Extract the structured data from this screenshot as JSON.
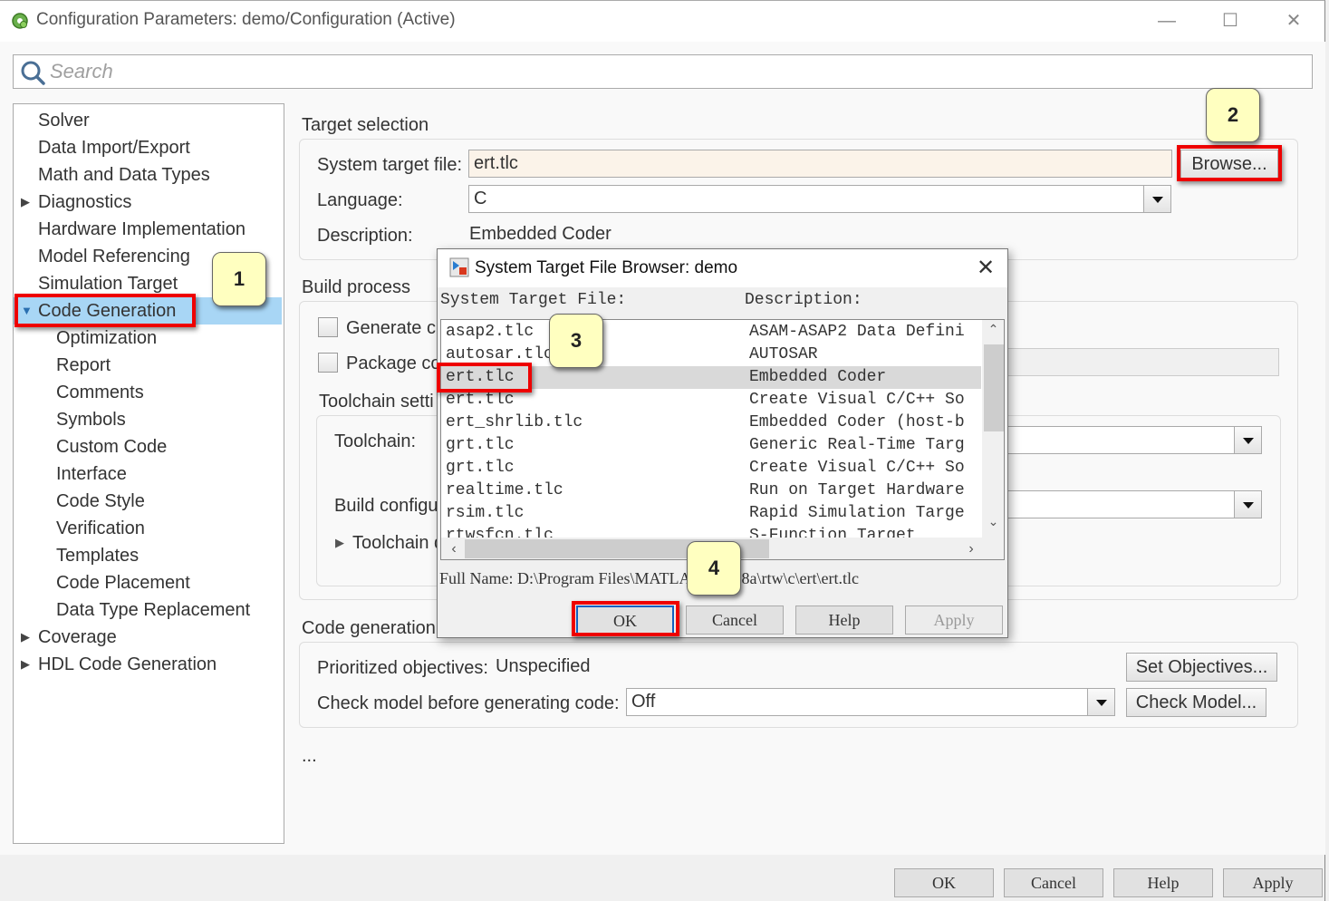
{
  "window": {
    "title": "Configuration Parameters: demo/Configuration (Active)",
    "controls": {
      "minimize": "—",
      "maximize": "☐",
      "close": "✕"
    }
  },
  "search": {
    "placeholder": "Search",
    "value": ""
  },
  "tree": {
    "items": [
      {
        "label": "Solver",
        "level": 0,
        "expander": ""
      },
      {
        "label": "Data Import/Export",
        "level": 0,
        "expander": ""
      },
      {
        "label": "Math and Data Types",
        "level": 0,
        "expander": ""
      },
      {
        "label": "Diagnostics",
        "level": 0,
        "expander": "collapsed"
      },
      {
        "label": "Hardware Implementation",
        "level": 0,
        "expander": ""
      },
      {
        "label": "Model Referencing",
        "level": 0,
        "expander": ""
      },
      {
        "label": "Simulation Target",
        "level": 0,
        "expander": ""
      },
      {
        "label": "Code Generation",
        "level": 0,
        "expander": "expanded",
        "selected": true
      },
      {
        "label": "Optimization",
        "level": 1,
        "expander": ""
      },
      {
        "label": "Report",
        "level": 1,
        "expander": ""
      },
      {
        "label": "Comments",
        "level": 1,
        "expander": ""
      },
      {
        "label": "Symbols",
        "level": 1,
        "expander": ""
      },
      {
        "label": "Custom Code",
        "level": 1,
        "expander": ""
      },
      {
        "label": "Interface",
        "level": 1,
        "expander": ""
      },
      {
        "label": "Code Style",
        "level": 1,
        "expander": ""
      },
      {
        "label": "Verification",
        "level": 1,
        "expander": ""
      },
      {
        "label": "Templates",
        "level": 1,
        "expander": ""
      },
      {
        "label": "Code Placement",
        "level": 1,
        "expander": ""
      },
      {
        "label": "Data Type Replacement",
        "level": 1,
        "expander": ""
      },
      {
        "label": "Coverage",
        "level": 0,
        "expander": "collapsed"
      },
      {
        "label": "HDL Code Generation",
        "level": 0,
        "expander": "collapsed"
      }
    ],
    "expander_glyphs": {
      "collapsed": "▶",
      "expanded": "▼"
    }
  },
  "target_selection": {
    "title": "Target selection",
    "system_target_file_label": "System target file:",
    "system_target_file_value": "ert.tlc",
    "browse_label": "Browse...",
    "language_label": "Language:",
    "language_value": "C",
    "description_label": "Description:",
    "description_value": "Embedded Coder"
  },
  "build_process": {
    "title": "Build process",
    "generate_code_only_label": "Generate c",
    "generate_code_only_checked": false,
    "package_code_label": "Package co",
    "package_code_checked": false,
    "toolchain_settings_title": "Toolchain setti",
    "toolchain_label": "Toolchain:",
    "toolchain_value": "",
    "build_configuration_label": "Build configu",
    "build_configuration_value": "",
    "toolchain_details_label": "Toolchain d",
    "expander_glyph": "▶"
  },
  "code_generation_objectives": {
    "title": "Code generation",
    "prioritized_objectives_label": "Prioritized objectives:",
    "prioritized_objectives_value": "Unspecified",
    "set_objectives_label": "Set Objectives...",
    "check_model_label_text": "Check model before generating code:",
    "check_model_value": "Off",
    "check_model_button": "Check Model..."
  },
  "more_indicator": "...",
  "bottom_buttons": {
    "ok": "OK",
    "cancel": "Cancel",
    "help": "Help",
    "apply": "Apply"
  },
  "browser_dialog": {
    "title": "System Target File Browser: demo",
    "close": "✕",
    "column_file": "System Target File:",
    "column_description": "Description:",
    "rows": [
      {
        "file": "asap2.tlc",
        "description": "ASAM-ASAP2 Data Defini"
      },
      {
        "file": "autosar.tlc",
        "description": "AUTOSAR"
      },
      {
        "file": "ert.tlc",
        "description": "Embedded Coder",
        "selected": true
      },
      {
        "file": "ert.tlc",
        "description": "Create Visual C/C++ So"
      },
      {
        "file": "ert_shrlib.tlc",
        "description": "Embedded Coder (host-b"
      },
      {
        "file": "grt.tlc",
        "description": "Generic Real-Time Targ"
      },
      {
        "file": "grt.tlc",
        "description": "Create Visual C/C++ So"
      },
      {
        "file": "realtime.tlc",
        "description": "Run on Target Hardware"
      },
      {
        "file": "rsim.tlc",
        "description": "Rapid Simulation Targe"
      },
      {
        "file": "rtwsfcn.tlc",
        "description": "S-Function Target"
      }
    ],
    "scroll_glyphs": {
      "up": "⌃",
      "down": "⌄",
      "left": "‹",
      "right": "›"
    },
    "full_name": "Full Name: D:\\Program Files\\MATLAB\\R2018a\\rtw\\c\\ert\\ert.tlc",
    "buttons": {
      "ok": "OK",
      "cancel": "Cancel",
      "help": "Help",
      "apply": "Apply"
    }
  },
  "annotations": {
    "callouts": [
      "1",
      "2",
      "3",
      "4"
    ],
    "highlight_color": "#ee0000",
    "callout_color": "#ffffc0"
  },
  "colors": {
    "selection": "#a8d6f5",
    "target_file_field": "#fbf3e9",
    "list_selection": "#d9d9d9"
  }
}
